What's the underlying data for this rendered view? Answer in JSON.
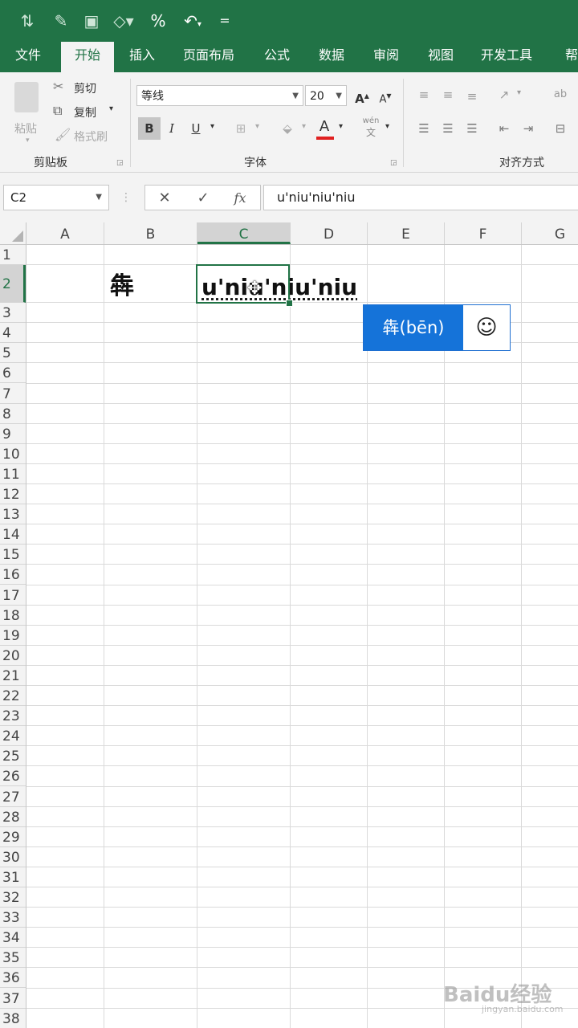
{
  "quick_access": {
    "icons": [
      "sort-icon",
      "format-painter-icon",
      "paste-special-icon",
      "shape-icon",
      "percent-icon",
      "undo-icon",
      "customize-icon"
    ],
    "percent_label": "%",
    "undo_label": "↶",
    "customize_label": "="
  },
  "tabs": [
    "文件",
    "开始",
    "插入",
    "页面布局",
    "公式",
    "数据",
    "审阅",
    "视图",
    "开发工具",
    "帮助"
  ],
  "active_tab": "开始",
  "ribbon": {
    "clipboard": {
      "paste_label": "粘贴",
      "cut_label": "剪切",
      "copy_label": "复制",
      "format_painter_label": "格式刷",
      "group_label": "剪贴板"
    },
    "font": {
      "font_name": "等线",
      "font_size": "20",
      "bold_label": "B",
      "italic_label": "I",
      "underline_label": "U",
      "font_color_label": "A",
      "pinyin_label": "wén",
      "grow_label": "A",
      "shrink_label": "A",
      "group_label": "字体",
      "font_color": "#e02020"
    },
    "alignment": {
      "group_label": "对齐方式"
    }
  },
  "formula_bar": {
    "name_box": "C2",
    "cancel_label": "✕",
    "enter_label": "✓",
    "fx_label": "fx",
    "value": "u'niu'niu'niu"
  },
  "grid": {
    "columns": [
      "A",
      "B",
      "C",
      "D",
      "E",
      "F",
      "G"
    ],
    "selected_column": "C",
    "rows": [
      "1",
      "2",
      "3",
      "4",
      "5",
      "6",
      "7",
      "8",
      "9",
      "10",
      "11",
      "12",
      "13",
      "14",
      "15",
      "16",
      "17",
      "18",
      "19",
      "20",
      "21",
      "22",
      "23",
      "24",
      "25",
      "26",
      "27",
      "28",
      "29",
      "30",
      "31",
      "32",
      "33",
      "34",
      "35",
      "36",
      "37",
      "38"
    ],
    "selected_row": "2",
    "cells": {
      "B2": "犇",
      "C2": "u'niu'niu'niu"
    }
  },
  "ime_popup": {
    "candidate": "犇(bēn)",
    "emoji_label": "☺"
  },
  "watermark": {
    "text": "Baidu经验",
    "sub": "jingyan.baidu.com"
  },
  "colors": {
    "excel_green": "#217346",
    "ime_blue": "#1573d9"
  }
}
